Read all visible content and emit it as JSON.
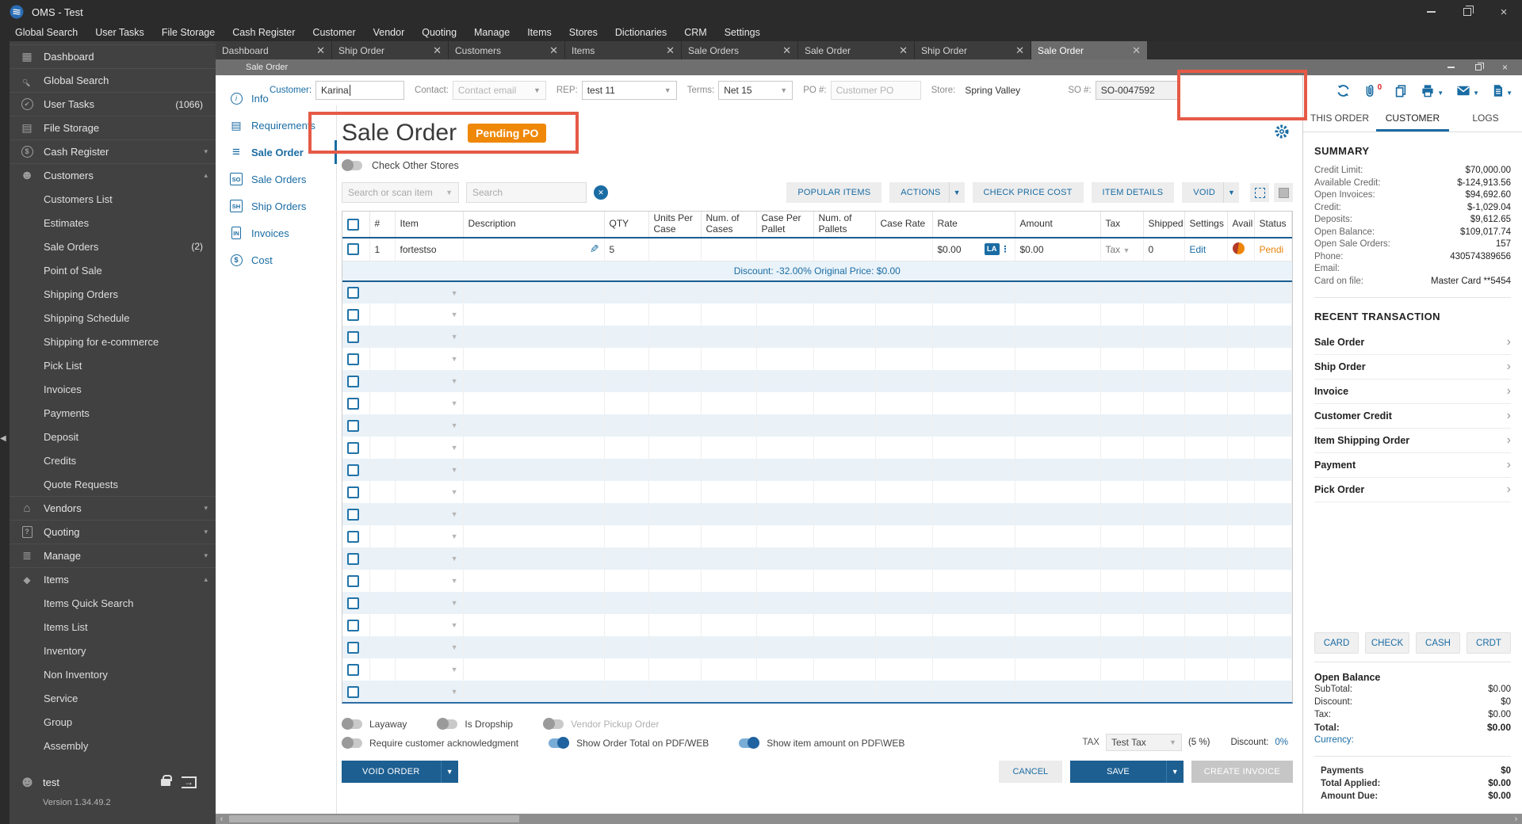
{
  "window": {
    "title": "OMS - Test"
  },
  "menu": [
    "Global Search",
    "User Tasks",
    "File Storage",
    "Cash Register",
    "Customer",
    "Vendor",
    "Quoting",
    "Manage",
    "Items",
    "Stores",
    "Dictionaries",
    "CRM",
    "Settings"
  ],
  "tabs": [
    {
      "label": "Dashboard"
    },
    {
      "label": "Ship Order"
    },
    {
      "label": "Customers"
    },
    {
      "label": "Items"
    },
    {
      "label": "Sale Orders"
    },
    {
      "label": "Sale Order"
    },
    {
      "label": "Ship Order"
    },
    {
      "label": "Sale Order",
      "active": true
    }
  ],
  "sidebar": {
    "items": [
      {
        "label": "Dashboard",
        "icon": "dashboard"
      },
      {
        "label": "Global Search",
        "icon": "search"
      },
      {
        "label": "User Tasks",
        "icon": "tasks",
        "badge": "(1066)"
      },
      {
        "label": "File Storage",
        "icon": "folder"
      },
      {
        "label": "Cash Register",
        "icon": "cash",
        "chev": "▾"
      },
      {
        "label": "Customers",
        "icon": "person",
        "chev": "▴"
      },
      {
        "label": "Customers List",
        "child": true
      },
      {
        "label": "Estimates",
        "child": true
      },
      {
        "label": "Sale Orders",
        "child": true,
        "badge": "(2)"
      },
      {
        "label": "Point of Sale",
        "child": true
      },
      {
        "label": "Shipping Orders",
        "child": true
      },
      {
        "label": "Shipping Schedule",
        "child": true
      },
      {
        "label": "Shipping for e-commerce",
        "child": true
      },
      {
        "label": "Pick List",
        "child": true
      },
      {
        "label": "Invoices",
        "child": true
      },
      {
        "label": "Payments",
        "child": true
      },
      {
        "label": "Deposit",
        "child": true
      },
      {
        "label": "Credits",
        "child": true
      },
      {
        "label": "Quote Requests",
        "child": true
      },
      {
        "label": "Vendors",
        "icon": "store",
        "chev": "▾"
      },
      {
        "label": "Quoting",
        "icon": "quoting",
        "chev": "▾"
      },
      {
        "label": "Manage",
        "icon": "manage",
        "chev": "▾"
      },
      {
        "label": "Items",
        "icon": "items",
        "chev": "▴"
      },
      {
        "label": "Items Quick Search",
        "child": true
      },
      {
        "label": "Items List",
        "child": true
      },
      {
        "label": "Inventory",
        "child": true
      },
      {
        "label": "Non Inventory",
        "child": true
      },
      {
        "label": "Service",
        "child": true
      },
      {
        "label": "Group",
        "child": true
      },
      {
        "label": "Assembly",
        "child": true
      }
    ],
    "user": "test",
    "version": "Version 1.34.49.2"
  },
  "inner_window": {
    "title": "Sale Order"
  },
  "form": {
    "customer": {
      "label": "Customer:",
      "value": "Karina"
    },
    "contact": {
      "label": "Contact:",
      "placeholder": "Contact email"
    },
    "rep": {
      "label": "REP:",
      "value": "test 11"
    },
    "terms": {
      "label": "Terms:",
      "value": "Net 15"
    },
    "po": {
      "label": "PO #:",
      "placeholder": "Customer PO"
    },
    "store": {
      "label": "Store:",
      "value": "Spring Valley"
    },
    "so": {
      "label": "SO #:",
      "value": "SO-0047592"
    }
  },
  "nav": {
    "items": [
      {
        "label": "Info",
        "icon": "info"
      },
      {
        "label": "Requirements",
        "icon": "req"
      },
      {
        "label": "Sale Order",
        "icon": "lines",
        "active": true
      },
      {
        "label": "Sale Orders",
        "icon": "so"
      },
      {
        "label": "Ship Orders",
        "icon": "sh"
      },
      {
        "label": "Invoices",
        "icon": "inv"
      },
      {
        "label": "Cost",
        "icon": "cost"
      }
    ]
  },
  "order": {
    "title": "Sale Order",
    "badge": "Pending PO",
    "check_other_stores": "Check Other Stores",
    "search_item_placeholder": "Search or scan item",
    "search_placeholder": "Search",
    "buttons": {
      "popular": "POPULAR ITEMS",
      "actions": "ACTIONS",
      "check_price": "CHECK PRICE COST",
      "item_details": "ITEM DETAILS",
      "void": "VOID"
    }
  },
  "table": {
    "columns": [
      "#",
      "Item",
      "Description",
      "QTY",
      "Units Per Case",
      "Num. of Cases",
      "Case Per Pallet",
      "Num. of Pallets",
      "Case Rate",
      "Rate",
      "Amount",
      "Tax",
      "Shipped",
      "Settings",
      "Avail",
      "Status"
    ],
    "row": {
      "num": "1",
      "item": "fortestso",
      "qty": "5",
      "rate": "$0.00",
      "rate_badge": "LA",
      "amount": "$0.00",
      "tax": "Tax",
      "shipped": "0",
      "settings": "Edit",
      "status": "Pendi"
    },
    "discount_note": "Discount: -32.00% Original Price: $0.00",
    "empty_rows": 19
  },
  "footer": {
    "toggles_row1": [
      {
        "label": "Layaway"
      },
      {
        "label": "Is Dropship"
      },
      {
        "label": "Vendor Pickup Order",
        "muted": true
      }
    ],
    "toggles_row2": [
      {
        "label": "Require customer acknowledgment"
      },
      {
        "label": "Show Order Total on PDF/WEB",
        "on": true
      },
      {
        "label": "Show item amount on PDF\\WEB",
        "on": true
      }
    ],
    "tax_label": "TAX",
    "tax_value": "Test Tax",
    "tax_rate": "(5 %)",
    "discount_label": "Discount:",
    "discount_value": "0%",
    "void_order": "VOID ORDER",
    "cancel": "CANCEL",
    "save": "SAVE",
    "create_invoice": "CREATE INVOICE"
  },
  "right_panel": {
    "attachment_count": "0",
    "tabs": [
      {
        "label": "THIS ORDER"
      },
      {
        "label": "CUSTOMER",
        "active": true
      },
      {
        "label": "LOGS"
      }
    ],
    "summary_title": "SUMMARY",
    "summary": [
      {
        "label": "Credit Limit:",
        "value": "$70,000.00"
      },
      {
        "label": "Available Credit:",
        "value": "$-124,913.56"
      },
      {
        "label": "Open Invoices:",
        "value": "$94,692.60"
      },
      {
        "label": "Credit:",
        "value": "$-1,029.04"
      },
      {
        "label": "Deposits:",
        "value": "$9,612.65"
      },
      {
        "label": "Open Balance:",
        "value": "$109,017.74"
      },
      {
        "label": "Open Sale Orders:",
        "value": "157"
      },
      {
        "label": "Phone:",
        "value": "430574389656"
      },
      {
        "label": "Email:",
        "value": ""
      },
      {
        "label": "Card on file:",
        "value": "Master Card **5454"
      }
    ],
    "recent_title": "RECENT TRANSACTION",
    "recent": [
      "Sale Order",
      "Ship Order",
      "Invoice",
      "Customer Credit",
      "Item Shipping Order",
      "Payment",
      "Pick Order"
    ],
    "pay_buttons": [
      "CARD",
      "CHECK",
      "CASH",
      "CRDT"
    ],
    "totals_title": "Open Balance",
    "totals": [
      {
        "label": "SubTotal:",
        "value": "$0.00"
      },
      {
        "label": "Discount:",
        "value": "$0"
      },
      {
        "label": "Tax:",
        "value": "$0.00"
      },
      {
        "label": "Total:",
        "value": "$0.00",
        "bold": true
      }
    ],
    "currency_label": "Currency:",
    "payments": [
      {
        "label": "Payments",
        "value": "$0"
      },
      {
        "label": "Total Applied:",
        "value": "$0.00"
      },
      {
        "label": "Amount Due:",
        "value": "$0.00"
      }
    ]
  }
}
